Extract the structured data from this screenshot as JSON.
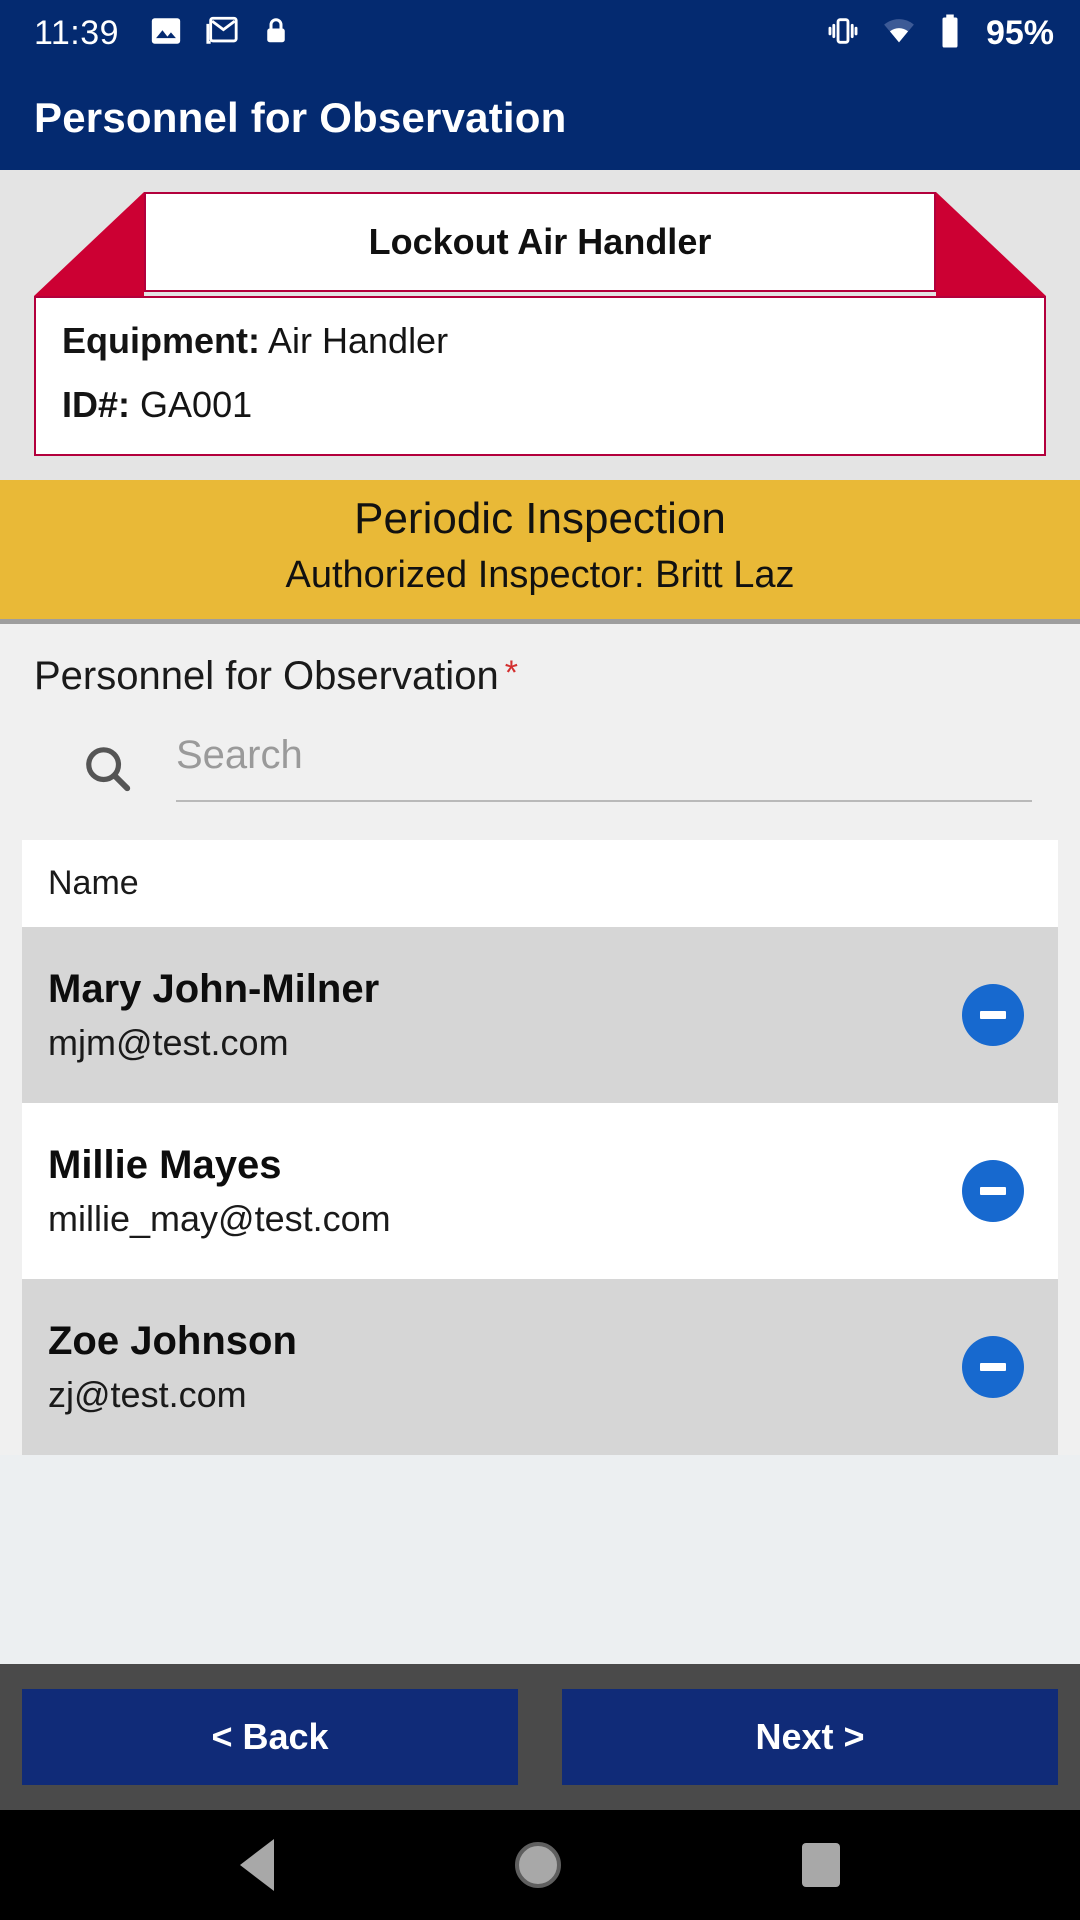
{
  "status_bar": {
    "time": "11:39",
    "battery_percent": "95%",
    "left_icons": [
      "photo-icon",
      "gmail-icon",
      "lock-icon"
    ],
    "right_icons": [
      "vibrate-icon",
      "wifi-icon",
      "battery-icon"
    ]
  },
  "app_bar": {
    "title": "Personnel for Observation"
  },
  "equipment_card": {
    "ribbon_title": "Lockout Air Handler",
    "equipment_label": "Equipment:",
    "equipment_value": "Air Handler",
    "id_label": "ID#:",
    "id_value": "GA001"
  },
  "inspection_banner": {
    "type": "Periodic Inspection",
    "authorized_inspector": "Authorized Inspector: Britt Laz"
  },
  "form": {
    "field_label": "Personnel for Observation",
    "required_marker": "*",
    "search": {
      "placeholder": "Search",
      "value": ""
    }
  },
  "table": {
    "columns": [
      "Name"
    ],
    "rows": [
      {
        "name": "Mary John-Milner",
        "email": "mjm@test.com",
        "action": "remove"
      },
      {
        "name": "Millie Mayes",
        "email": "millie_may@test.com",
        "action": "remove"
      },
      {
        "name": "Zoe Johnson",
        "email": "zj@test.com",
        "action": "remove"
      }
    ]
  },
  "footer": {
    "back_label": "< Back",
    "next_label": "Next >"
  },
  "android_nav": {
    "back": "back-icon",
    "home": "home-icon",
    "recents": "recents-icon"
  },
  "colors": {
    "app_bar": "#042a70",
    "ribbon_red": "#cc0033",
    "banner_gold": "#e9b937",
    "accent_blue": "#1769cf",
    "button_navy": "#102b78",
    "required_red": "#d32f2f"
  }
}
